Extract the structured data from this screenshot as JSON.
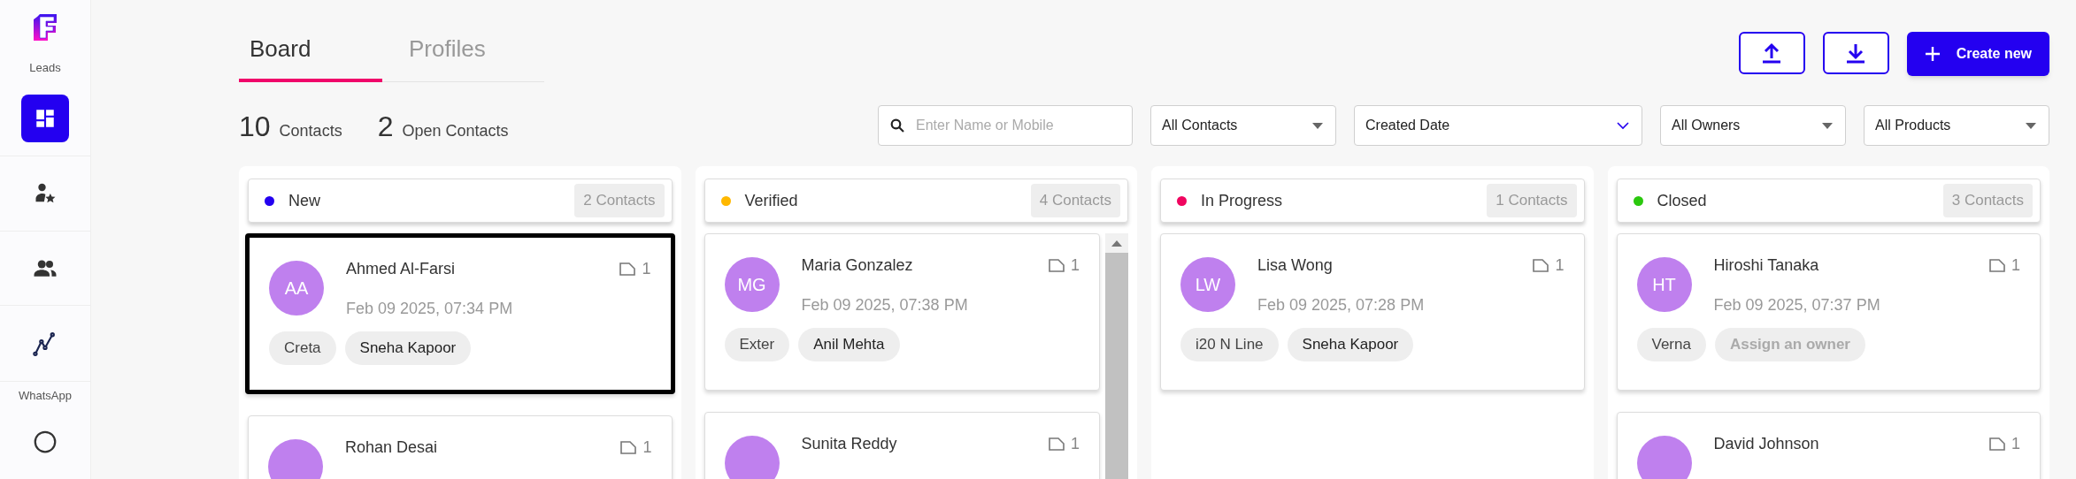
{
  "sidebar": {
    "section_label": "Leads",
    "nav": [
      {
        "kind": "board",
        "selected": true
      },
      {
        "kind": "contact-star",
        "selected": false
      },
      {
        "kind": "people",
        "selected": false
      },
      {
        "kind": "graph",
        "selected": false
      }
    ],
    "footer_label": "WhatsApp",
    "footer_nav": [
      {
        "kind": "chat",
        "selected": false
      }
    ]
  },
  "tabs": [
    {
      "label": "Board",
      "selected": true
    },
    {
      "label": "Profiles",
      "selected": false
    }
  ],
  "summary": [
    {
      "count": "10",
      "label": "Contacts"
    },
    {
      "count": "2",
      "label": "Open Contacts"
    }
  ],
  "actions": [
    {
      "kind": "upload"
    },
    {
      "kind": "download"
    },
    {
      "kind": "create",
      "label": "Create new"
    }
  ],
  "search": {
    "placeholder": "Enter Name or Mobile"
  },
  "filters": [
    {
      "kind": "dropdown",
      "value": "All Contacts"
    },
    {
      "kind": "sort",
      "value": "Created Date"
    },
    {
      "kind": "dropdown",
      "value": "All Owners"
    },
    {
      "kind": "dropdown",
      "value": "All Products"
    }
  ],
  "columns": [
    {
      "title": "New",
      "color": "#2400f0",
      "count": "2 Contacts",
      "scrollable": false,
      "cards": [
        {
          "initials": "AA",
          "name": "Ahmed Al-Farsi",
          "notes": "1",
          "date": "Feb 09 2025, 07:34 PM",
          "selected": true,
          "tags": [
            {
              "kind": "product",
              "label": "Creta"
            },
            {
              "kind": "owner",
              "label": "Sneha Kapoor"
            }
          ]
        },
        {
          "name": "Rohan Desai",
          "notes": "1",
          "selected": false
        }
      ]
    },
    {
      "title": "Verified",
      "color": "#ffb800",
      "count": "4 Contacts",
      "scrollable": true,
      "cards": [
        {
          "initials": "MG",
          "name": "Maria Gonzalez",
          "notes": "1",
          "date": "Feb 09 2025, 07:38 PM",
          "selected": false,
          "tags": [
            {
              "kind": "product",
              "label": "Exter"
            },
            {
              "kind": "owner",
              "label": "Anil Mehta"
            }
          ]
        },
        {
          "name": "Sunita Reddy",
          "notes": "1",
          "selected": false
        }
      ]
    },
    {
      "title": "In Progress",
      "color": "#f0055f",
      "count": "1 Contacts",
      "scrollable": false,
      "cards": [
        {
          "initials": "LW",
          "name": "Lisa Wong",
          "notes": "1",
          "date": "Feb 09 2025, 07:28 PM",
          "selected": false,
          "tags": [
            {
              "kind": "product",
              "label": "i20 N Line"
            },
            {
              "kind": "owner",
              "label": "Sneha Kapoor"
            }
          ]
        }
      ]
    },
    {
      "title": "Closed",
      "color": "#2bc80e",
      "count": "3 Contacts",
      "scrollable": false,
      "cards": [
        {
          "initials": "HT",
          "name": "Hiroshi Tanaka",
          "notes": "1",
          "date": "Feb 09 2025, 07:37 PM",
          "selected": false,
          "tags": [
            {
              "kind": "product",
              "label": "Verna"
            },
            {
              "kind": "unassigned",
              "label": "Assign an owner"
            }
          ]
        },
        {
          "name": "David Johnson",
          "notes": "1",
          "selected": false
        }
      ]
    }
  ]
}
